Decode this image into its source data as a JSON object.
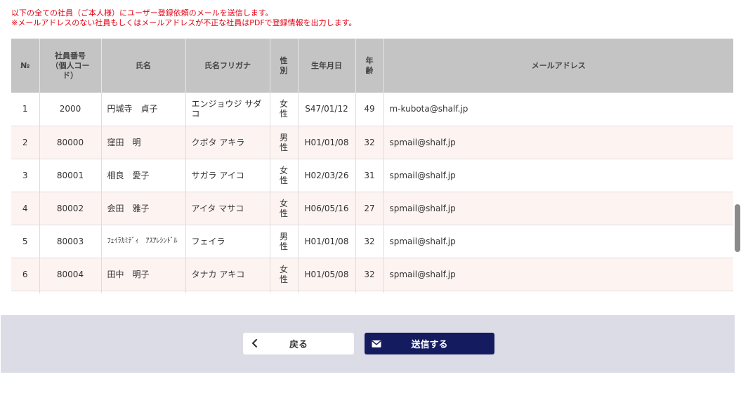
{
  "notice": {
    "line1": "以下の全ての社員（ご本人様）にユーザー登録依頼のメールを送信します。",
    "line2": "※メールアドレスのない社員もしくはメールアドレスが不正な社員はPDFで登録情報を出力します。"
  },
  "table": {
    "headers": {
      "no": "№",
      "employee_no": "社員番号（個人コード）",
      "name": "氏名",
      "kana": "氏名フリガナ",
      "gender": "性別",
      "birthdate": "生年月日",
      "age": "年齢",
      "email": "メールアドレス"
    },
    "rows": [
      {
        "no": "1",
        "employee_no": "2000",
        "name": "円城寺　貞子",
        "kana": "エンジョウジ サダコ",
        "gender": "女性",
        "birthdate": "S47/01/12",
        "age": "49",
        "email": "m-kubota@shalf.jp"
      },
      {
        "no": "2",
        "employee_no": "80000",
        "name": "窪田　明",
        "kana": "クボタ アキラ",
        "gender": "男性",
        "birthdate": "H01/01/08",
        "age": "32",
        "email": "spmail@shalf.jp"
      },
      {
        "no": "3",
        "employee_no": "80001",
        "name": "相良　愛子",
        "kana": "サガラ アイコ",
        "gender": "女性",
        "birthdate": "H02/03/26",
        "age": "31",
        "email": "spmail@shalf.jp"
      },
      {
        "no": "4",
        "employee_no": "80002",
        "name": "会田　雅子",
        "kana": "アイタ マサコ",
        "gender": "女性",
        "birthdate": "H06/05/16",
        "age": "27",
        "email": "spmail@shalf.jp"
      },
      {
        "no": "5",
        "employee_no": "80003",
        "name": "ﾌｪｲﾗｶﾐﾃﾞｨ　ｱｽｱﾚｼﾝﾄﾞﾙ",
        "kana": "フェイラ",
        "gender": "男性",
        "birthdate": "H01/01/08",
        "age": "32",
        "email": "spmail@shalf.jp"
      },
      {
        "no": "6",
        "employee_no": "80004",
        "name": "田中　明子",
        "kana": "タナカ アキコ",
        "gender": "女性",
        "birthdate": "H01/05/08",
        "age": "32",
        "email": "spmail@shalf.jp"
      }
    ]
  },
  "footer": {
    "back_label": "戻る",
    "send_label": "送信する",
    "back_icon": "chevron-left-icon",
    "send_icon": "envelope-icon"
  },
  "colors": {
    "notice_red": "#e60012",
    "header_gray": "#c4c4c4",
    "row_pink": "#fdf4f2",
    "footer_bg": "#dcdce6",
    "send_navy": "#141b5e"
  }
}
